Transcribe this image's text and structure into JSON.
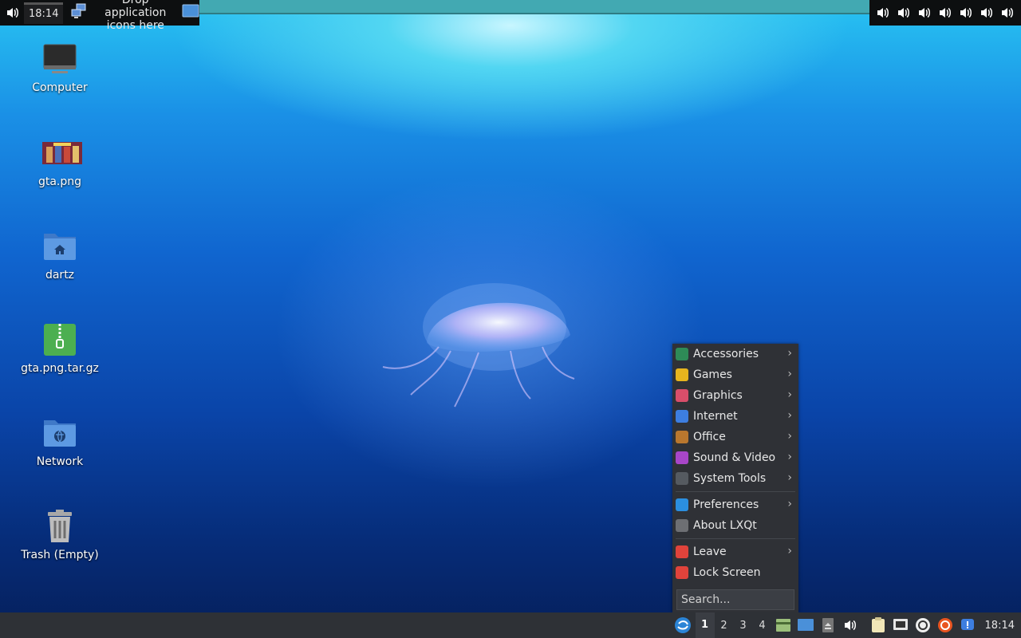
{
  "top_panel": {
    "clock": "18:14",
    "drop_text": "Drop application icons here",
    "volume_icon_count": 7
  },
  "desktop_icons": [
    {
      "label": "Computer",
      "icon": "computer-icon"
    },
    {
      "label": "gta.png",
      "icon": "image-thumbnail-icon"
    },
    {
      "label": "dartz",
      "icon": "home-folder-icon"
    },
    {
      "label": "gta.png.tar.gz",
      "icon": "archive-icon"
    },
    {
      "label": "Network",
      "icon": "network-folder-icon"
    },
    {
      "label": "Trash (Empty)",
      "icon": "trash-icon"
    }
  ],
  "menu": {
    "items": [
      {
        "label": "Accessories",
        "icon": "accessories-icon",
        "color": "#2e8b57",
        "submenu": true
      },
      {
        "label": "Games",
        "icon": "games-icon",
        "color": "#e6b41e",
        "submenu": true
      },
      {
        "label": "Graphics",
        "icon": "graphics-icon",
        "color": "#d94e6a",
        "submenu": true
      },
      {
        "label": "Internet",
        "icon": "internet-icon",
        "color": "#3d7ee0",
        "submenu": true
      },
      {
        "label": "Office",
        "icon": "office-icon",
        "color": "#b9772e",
        "submenu": true
      },
      {
        "label": "Sound & Video",
        "icon": "sound-video-icon",
        "color": "#a846c8",
        "submenu": true
      },
      {
        "label": "System Tools",
        "icon": "system-tools-icon",
        "color": "#555a60",
        "submenu": true
      },
      {
        "label": "Preferences",
        "icon": "preferences-icon",
        "color": "#2b8fe0",
        "submenu": true
      },
      {
        "label": "About LXQt",
        "icon": "info-icon",
        "color": "#6d6f73",
        "submenu": false
      },
      {
        "label": "Leave",
        "icon": "power-icon",
        "color": "#e0433b",
        "submenu": true
      },
      {
        "label": "Lock Screen",
        "icon": "lock-icon",
        "color": "#e0433b",
        "submenu": false
      }
    ],
    "search_placeholder": "Search..."
  },
  "bottom_panel": {
    "workspaces": [
      "1",
      "2",
      "3",
      "4"
    ],
    "active_workspace": "1",
    "clock": "18:14"
  }
}
